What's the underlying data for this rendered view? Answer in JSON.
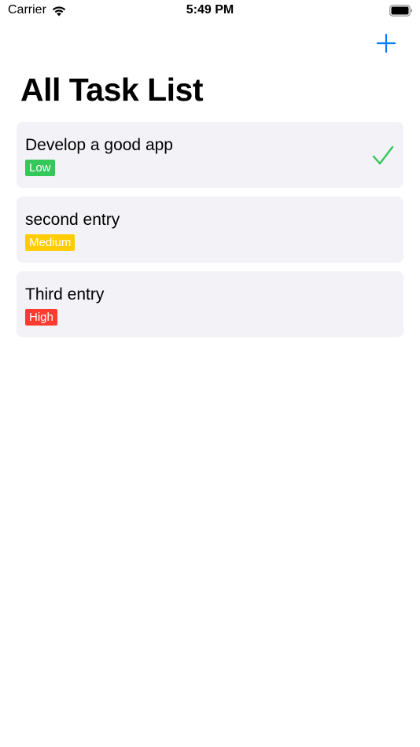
{
  "status_bar": {
    "carrier": "Carrier",
    "time": "5:49 PM",
    "icons": [
      "wifi-icon",
      "battery-icon"
    ]
  },
  "nav": {
    "add_icon": "plus-icon",
    "accent_color": "#007aff"
  },
  "page": {
    "title": "All Task List"
  },
  "tasks": [
    {
      "title": "Develop a good app",
      "priority": "Low",
      "priority_color": "#34c759",
      "completed": true
    },
    {
      "title": "second entry",
      "priority": "Medium",
      "priority_color": "#ffcc00",
      "completed": false
    },
    {
      "title": "Third entry",
      "priority": "High",
      "priority_color": "#ff3b30",
      "completed": false
    }
  ],
  "colors": {
    "card_background": "#f2f2f7",
    "check_color": "#34c759"
  }
}
